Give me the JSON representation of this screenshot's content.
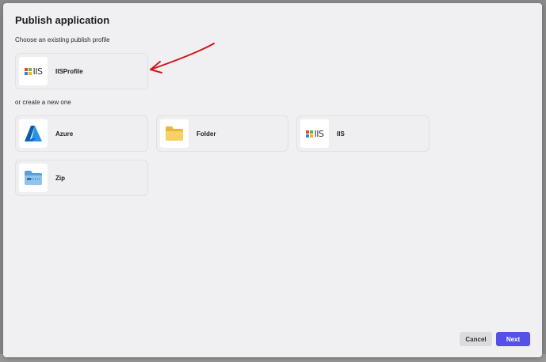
{
  "dialog": {
    "title": "Publish application",
    "existing_label": "Choose an existing publish profile",
    "new_label": "or create a new one"
  },
  "existing_profiles": [
    {
      "label": "IISProfile",
      "icon": "iis-logo-icon",
      "logo_text": "IIS"
    }
  ],
  "new_targets": [
    {
      "label": "Azure",
      "icon": "azure-icon"
    },
    {
      "label": "Folder",
      "icon": "folder-icon"
    },
    {
      "label": "IIS",
      "icon": "iis-logo-icon",
      "logo_text": "IIS"
    },
    {
      "label": "Zip",
      "icon": "zip-folder-icon"
    }
  ],
  "footer": {
    "cancel_label": "Cancel",
    "next_label": "Next"
  },
  "colors": {
    "accent": "#5551e8",
    "annotation_arrow": "#d01818",
    "azure": "#0a6fd1",
    "folder": "#f5c94d"
  }
}
